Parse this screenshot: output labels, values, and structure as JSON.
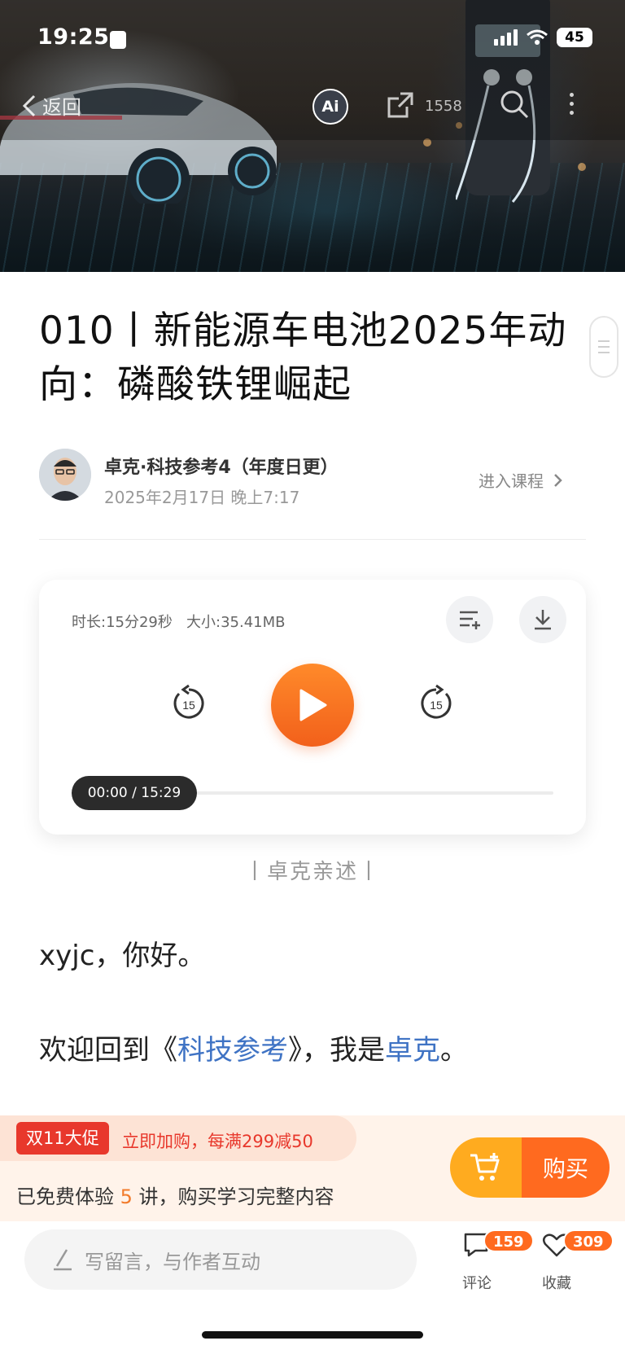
{
  "status_bar": {
    "time": "19:25",
    "battery": "45"
  },
  "nav": {
    "back_label": "返回",
    "ai_label": "Ai",
    "share_count": "1558"
  },
  "article": {
    "title": "010丨新能源车电池2025年动向：磷酸铁锂崛起",
    "author": "卓克·科技参考4（年度日更）",
    "date": "2025年2月17日 晚上7:17",
    "enter_course": "进入课程"
  },
  "audio": {
    "info": "时长:15分29秒   大小:35.41MB",
    "rewind_seconds": "15",
    "forward_seconds": "15",
    "time_display": "00:00 / 15:29",
    "progress_fraction": 0
  },
  "narrator": "丨卓克亲述丨",
  "body": {
    "greeting": "xyjc，你好。",
    "welcome_prefix": "欢迎回到《",
    "welcome_link": "科技参考",
    "welcome_middle": "》，我是",
    "author_link": "卓克",
    "welcome_suffix": "。"
  },
  "promo": {
    "tag": "双11大促",
    "text": "立即加购，每满299减50",
    "trial_prefix": "已免费体验 ",
    "trial_count": "5",
    "trial_suffix": " 讲，购买学习完整内容",
    "buy_label": "购买"
  },
  "bottom_bar": {
    "comment_placeholder": "写留言，与作者互动",
    "comment_label": "评论",
    "comment_count": "159",
    "favorite_label": "收藏",
    "favorite_count": "309"
  },
  "colors": {
    "accent_orange": "#ff6a1f",
    "link_blue": "#3f73c4",
    "promo_red": "#e8382c"
  }
}
